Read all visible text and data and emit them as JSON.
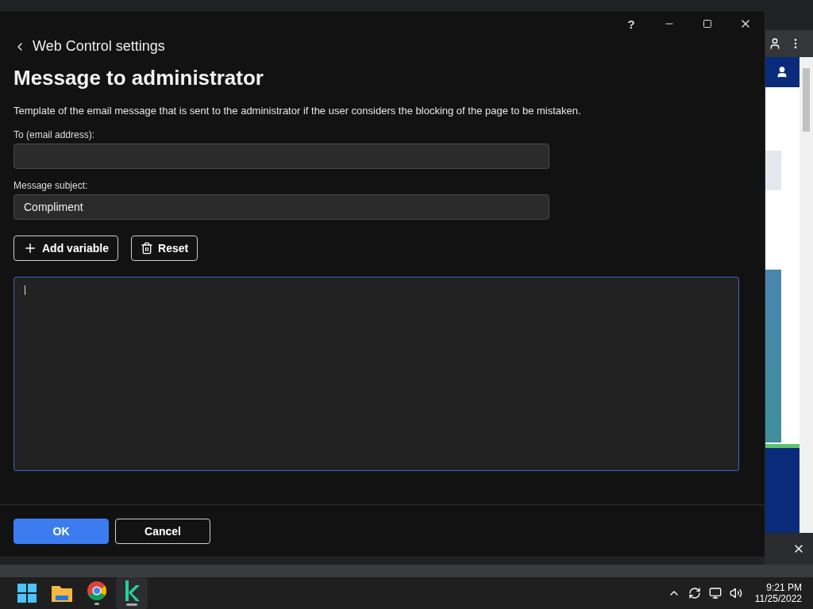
{
  "dialog": {
    "window_buttons": [
      {
        "kind": "help",
        "label": "?"
      },
      {
        "kind": "minimize"
      },
      {
        "kind": "maximize"
      },
      {
        "kind": "close"
      }
    ],
    "back_link": "Web Control settings",
    "title": "Message to administrator",
    "description": "Template of the email message that is sent to the administrator if the user considers the blocking of the page to be mistaken.",
    "fields": [
      {
        "label": "To (email address):"
      },
      {
        "label": "Message subject:",
        "value": "Compliment"
      }
    ],
    "toolbar": [
      {
        "kind": "add",
        "label": "Add variable"
      },
      {
        "kind": "reset",
        "label": "Reset"
      }
    ],
    "message_body": {
      "focused": true
    },
    "footer_buttons": [
      {
        "label": "OK",
        "primary": true
      },
      {
        "label": "Cancel",
        "primary": false
      }
    ]
  },
  "taskbar": {
    "apps": [
      {
        "kind": "start",
        "selected": false
      },
      {
        "kind": "files",
        "selected": false
      },
      {
        "kind": "browser",
        "selected": false,
        "running": true
      },
      {
        "kind": "kaspersky",
        "selected": true,
        "running": true
      }
    ],
    "time": "9:21 PM",
    "date": "11/25/2022"
  }
}
